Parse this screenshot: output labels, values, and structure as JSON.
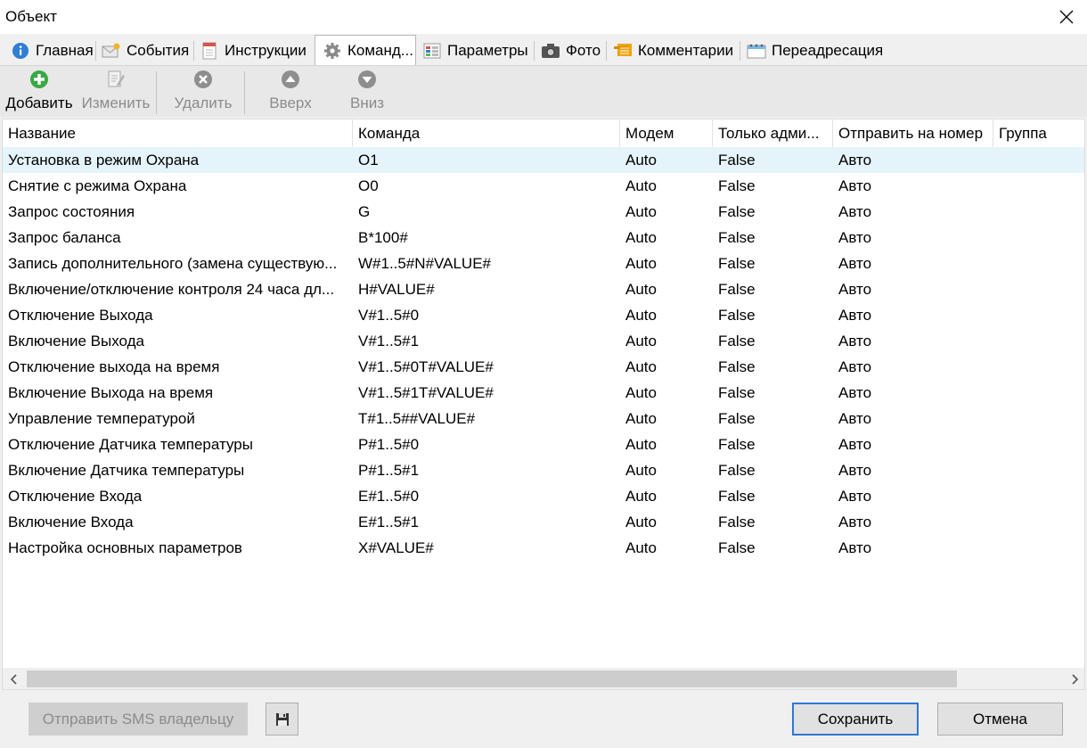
{
  "window": {
    "title": "Объект"
  },
  "tabs": [
    {
      "label": "Главная",
      "icon": "info-icon"
    },
    {
      "label": "События",
      "icon": "events-icon"
    },
    {
      "label": "Инструкции",
      "icon": "instructions-icon"
    },
    {
      "label": "Команд...",
      "icon": "gear-icon"
    },
    {
      "label": "Параметры",
      "icon": "parameters-icon"
    },
    {
      "label": "Фото",
      "icon": "camera-icon"
    },
    {
      "label": "Комментарии",
      "icon": "comments-icon"
    },
    {
      "label": "Переадресация",
      "icon": "redirect-icon"
    }
  ],
  "toolbar": {
    "add": "Добавить",
    "edit": "Изменить",
    "delete": "Удалить",
    "up": "Вверх",
    "down": "Вниз"
  },
  "table": {
    "columns": [
      "Название",
      "Команда",
      "Модем",
      "Только адми...",
      "Отправить на номер",
      "Группа"
    ],
    "rows": [
      [
        "Установка в режим Охрана",
        "O1",
        "Auto",
        "False",
        "Авто"
      ],
      [
        "Снятие с режима Охрана",
        "O0",
        "Auto",
        "False",
        "Авто"
      ],
      [
        "Запрос состояния",
        "G",
        "Auto",
        "False",
        "Авто"
      ],
      [
        "Запрос баланса",
        "B*100#",
        "Auto",
        "False",
        "Авто"
      ],
      [
        "Запись дополнительного (замена существую...",
        "W#1..5#N#VALUE#",
        "Auto",
        "False",
        "Авто"
      ],
      [
        "Включение/отключение контроля 24 часа дл...",
        "H#VALUE#",
        "Auto",
        "False",
        "Авто"
      ],
      [
        "Отключение Выхода",
        "V#1..5#0",
        "Auto",
        "False",
        "Авто"
      ],
      [
        "Включение Выхода",
        "V#1..5#1",
        "Auto",
        "False",
        "Авто"
      ],
      [
        "Отключение выхода на время",
        "V#1..5#0T#VALUE#",
        "Auto",
        "False",
        "Авто"
      ],
      [
        "Включение Выхода на время",
        "V#1..5#1T#VALUE#",
        "Auto",
        "False",
        "Авто"
      ],
      [
        "Управление температурой",
        "T#1..5##VALUE#",
        "Auto",
        "False",
        "Авто"
      ],
      [
        "Отключение Датчика температуры",
        "P#1..5#0",
        "Auto",
        "False",
        "Авто"
      ],
      [
        "Включение Датчика температуры",
        "P#1..5#1",
        "Auto",
        "False",
        "Авто"
      ],
      [
        "Отключение Входа",
        "E#1..5#0",
        "Auto",
        "False",
        "Авто"
      ],
      [
        "Включение Входа",
        "E#1..5#1",
        "Auto",
        "False",
        "Авто"
      ],
      [
        "Настройка основных параметров",
        "X#VALUE#",
        "Auto",
        "False",
        "Авто"
      ]
    ]
  },
  "footer": {
    "send_sms": "Отправить SMS владельцу",
    "save": "Сохранить",
    "cancel": "Отмена"
  }
}
